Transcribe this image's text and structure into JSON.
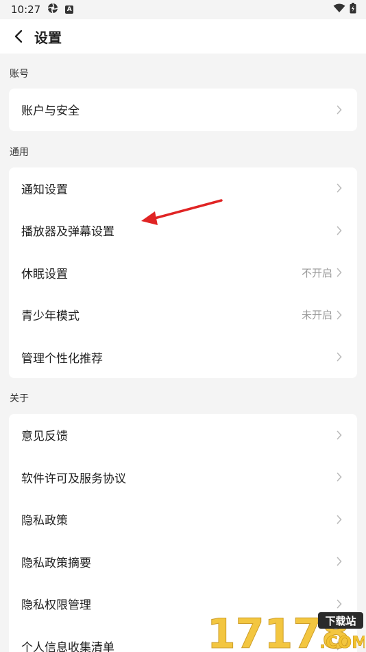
{
  "status_bar": {
    "time": "10:27",
    "badge": "A"
  },
  "header": {
    "title": "设置"
  },
  "sections": [
    {
      "label": "账号",
      "items": [
        {
          "label": "账户与安全",
          "value": ""
        }
      ]
    },
    {
      "label": "通用",
      "items": [
        {
          "label": "通知设置",
          "value": ""
        },
        {
          "label": "播放器及弹幕设置",
          "value": ""
        },
        {
          "label": "休眠设置",
          "value": "不开启"
        },
        {
          "label": "青少年模式",
          "value": "未开启"
        },
        {
          "label": "管理个性化推荐",
          "value": ""
        }
      ]
    },
    {
      "label": "关于",
      "items": [
        {
          "label": "意见反馈",
          "value": ""
        },
        {
          "label": "软件许可及服务协议",
          "value": ""
        },
        {
          "label": "隐私政策",
          "value": ""
        },
        {
          "label": "隐私政策摘要",
          "value": ""
        },
        {
          "label": "隐私权限管理",
          "value": ""
        },
        {
          "label": "个人信息收集清单",
          "value": ""
        }
      ]
    }
  ],
  "watermark": {
    "digits": "17178",
    "tag": "下载站",
    "suffix": ".COM"
  },
  "colors": {
    "annotation": "#e02424",
    "watermark_yellow": "#f2c230",
    "watermark_dark": "#2b2b2b"
  }
}
